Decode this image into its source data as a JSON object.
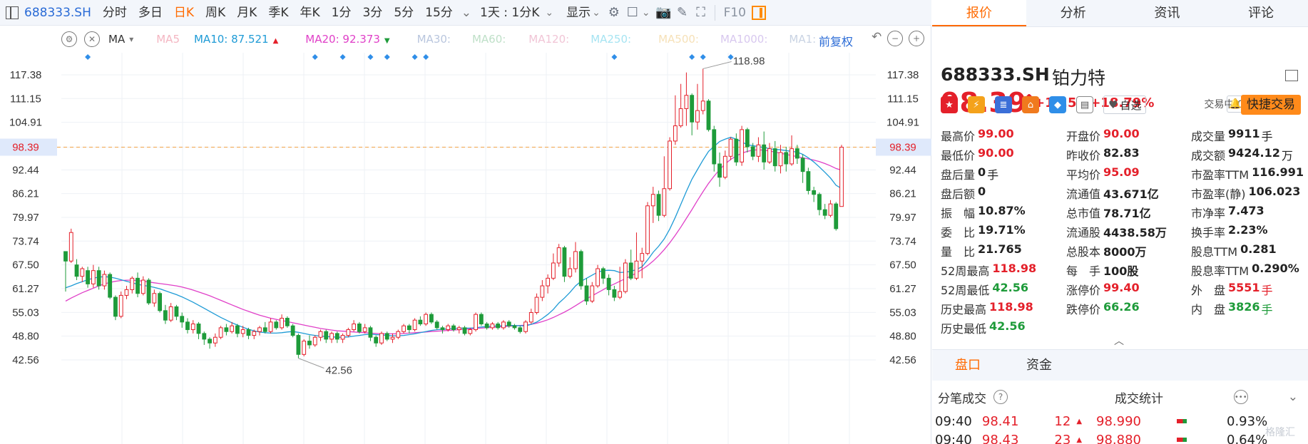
{
  "toolbar": {
    "code": "688333.SH",
    "periods": [
      "分时",
      "多日",
      "日K",
      "周K",
      "月K",
      "季K",
      "年K",
      "1分",
      "3分",
      "5分",
      "15分"
    ],
    "active_period": "日K",
    "more_chevron": "⌄",
    "interval_select": "1天 : 1分K",
    "display_label": "显示",
    "f10": "F10"
  },
  "ma_bar": {
    "ma_label": "MA",
    "items": [
      {
        "text": "MA5",
        "color": "#f4b6c2"
      },
      {
        "text": "MA10: 87.521",
        "color": "#1f9bd6",
        "arrow": "▲",
        "arrow_color": "#e4202a"
      },
      {
        "text": "MA20: 92.373",
        "color": "#e040c8",
        "arrow": "▼",
        "arrow_color": "#1e9b3a"
      },
      {
        "text": "MA30:",
        "color": "#b9c6de"
      },
      {
        "text": "MA60:",
        "color": "#bfe0c8"
      },
      {
        "text": "MA120:",
        "color": "#f1c5d6"
      },
      {
        "text": "MA250:",
        "color": "#a6e4f2"
      },
      {
        "text": "MA500:",
        "color": "#f6e1b8"
      },
      {
        "text": "MA1000:",
        "color": "#d8c8ef"
      },
      {
        "text": "MA1:",
        "color": "#c9d3e3"
      }
    ],
    "adjust_label": "前复权"
  },
  "chart_data": {
    "type": "candlestick",
    "y_ticks": [
      117.38,
      111.15,
      104.91,
      98.39,
      92.44,
      86.21,
      79.97,
      73.74,
      67.5,
      61.27,
      55.03,
      48.8,
      42.56
    ],
    "ylim": [
      40.2,
      121.4
    ],
    "current_price_label": "98.39",
    "high_annotation": "118.98",
    "low_annotation": "42.56",
    "ma10_color": "#1f9bd6",
    "ma20_color": "#e040c8",
    "up_color": "#e4202a",
    "down_color": "#1e9b3a",
    "candles": [
      [
        71.0,
        68.5,
        71.0,
        60.5
      ],
      [
        68.5,
        76.0,
        77.0,
        68.0
      ],
      [
        67.5,
        64.5,
        69.0,
        63.5
      ],
      [
        64.5,
        66.5,
        67.0,
        63.0
      ],
      [
        66.0,
        62.5,
        67.0,
        61.5
      ],
      [
        62.5,
        66.0,
        67.5,
        61.5
      ],
      [
        66.0,
        62.0,
        67.0,
        61.0
      ],
      [
        62.0,
        65.0,
        66.0,
        61.0
      ],
      [
        65.0,
        59.0,
        65.5,
        58.5
      ],
      [
        59.0,
        54.0,
        59.5,
        53.0
      ],
      [
        54.0,
        59.5,
        60.5,
        53.5
      ],
      [
        59.5,
        61.0,
        62.0,
        58.5
      ],
      [
        61.0,
        64.0,
        64.5,
        60.0
      ],
      [
        64.0,
        60.0,
        65.5,
        59.0
      ],
      [
        60.0,
        63.5,
        64.5,
        59.5
      ],
      [
        63.5,
        57.5,
        64.0,
        57.0
      ],
      [
        57.5,
        60.0,
        61.0,
        56.5
      ],
      [
        60.0,
        55.5,
        60.5,
        55.0
      ],
      [
        55.5,
        53.0,
        57.0,
        52.0
      ],
      [
        53.0,
        56.5,
        57.5,
        52.5
      ],
      [
        56.5,
        54.0,
        57.0,
        53.0
      ],
      [
        54.0,
        52.5,
        55.0,
        51.0
      ],
      [
        52.5,
        50.5,
        53.5,
        49.5
      ],
      [
        50.5,
        52.0,
        53.0,
        49.5
      ],
      [
        52.0,
        49.5,
        52.5,
        48.0
      ],
      [
        49.5,
        48.0,
        50.0,
        46.5
      ],
      [
        48.0,
        47.0,
        48.5,
        45.5
      ],
      [
        47.0,
        48.5,
        49.5,
        46.0
      ],
      [
        48.5,
        51.0,
        51.5,
        48.0
      ],
      [
        51.0,
        50.0,
        52.0,
        49.0
      ],
      [
        50.0,
        51.5,
        52.5,
        49.5
      ],
      [
        51.5,
        49.5,
        52.0,
        48.5
      ],
      [
        49.5,
        50.5,
        51.5,
        48.5
      ],
      [
        50.5,
        49.0,
        51.0,
        48.0
      ],
      [
        49.0,
        50.0,
        50.5,
        48.0
      ],
      [
        50.0,
        51.0,
        51.5,
        49.0
      ],
      [
        51.0,
        50.0,
        52.5,
        49.5
      ],
      [
        50.0,
        52.5,
        53.5,
        49.5
      ],
      [
        52.5,
        51.0,
        53.0,
        50.5
      ],
      [
        51.0,
        53.5,
        54.5,
        50.5
      ],
      [
        53.5,
        51.5,
        54.0,
        51.0
      ],
      [
        51.5,
        49.0,
        52.0,
        48.5
      ],
      [
        49.0,
        44.0,
        49.5,
        43.0
      ],
      [
        44.0,
        47.5,
        48.0,
        43.5
      ],
      [
        47.5,
        46.5,
        49.0,
        45.5
      ],
      [
        46.5,
        48.5,
        49.0,
        46.0
      ],
      [
        48.5,
        50.0,
        50.5,
        47.5
      ],
      [
        50.0,
        48.0,
        50.5,
        47.0
      ],
      [
        48.0,
        49.5,
        50.0,
        47.0
      ],
      [
        49.5,
        48.0,
        50.0,
        47.0
      ],
      [
        48.0,
        49.0,
        49.5,
        47.0
      ],
      [
        49.0,
        50.5,
        51.0,
        48.5
      ],
      [
        50.5,
        52.0,
        53.0,
        50.0
      ],
      [
        52.0,
        50.0,
        52.5,
        49.5
      ],
      [
        50.0,
        51.0,
        52.0,
        49.5
      ],
      [
        51.0,
        48.5,
        51.5,
        47.5
      ],
      [
        48.5,
        47.0,
        49.0,
        46.0
      ],
      [
        47.0,
        49.5,
        50.0,
        46.5
      ],
      [
        49.5,
        48.0,
        50.0,
        47.5
      ],
      [
        48.0,
        48.5,
        49.5,
        47.0
      ],
      [
        48.5,
        50.0,
        50.5,
        48.0
      ],
      [
        50.0,
        51.5,
        52.0,
        49.5
      ],
      [
        51.5,
        50.5,
        52.0,
        49.5
      ],
      [
        50.5,
        53.0,
        53.5,
        50.0
      ],
      [
        53.0,
        52.0,
        54.0,
        51.5
      ],
      [
        52.0,
        54.5,
        55.0,
        51.5
      ],
      [
        54.5,
        52.5,
        55.0,
        52.0
      ],
      [
        52.5,
        51.0,
        53.0,
        50.5
      ],
      [
        51.0,
        50.5,
        51.5,
        49.5
      ],
      [
        50.5,
        51.5,
        52.0,
        50.0
      ],
      [
        51.5,
        50.5,
        52.0,
        50.0
      ],
      [
        50.5,
        51.0,
        51.5,
        49.5
      ],
      [
        51.0,
        49.5,
        51.5,
        49.0
      ],
      [
        49.5,
        50.5,
        51.0,
        49.0
      ],
      [
        50.5,
        54.5,
        55.0,
        50.0
      ],
      [
        54.5,
        52.0,
        55.0,
        51.5
      ],
      [
        52.0,
        51.0,
        52.5,
        50.5
      ],
      [
        51.0,
        52.0,
        52.5,
        50.5
      ],
      [
        52.0,
        51.0,
        52.5,
        50.5
      ],
      [
        51.0,
        52.5,
        53.0,
        50.5
      ],
      [
        52.5,
        51.5,
        53.0,
        51.0
      ],
      [
        51.5,
        51.0,
        52.0,
        50.5
      ],
      [
        51.0,
        50.0,
        51.5,
        49.5
      ],
      [
        50.0,
        52.5,
        53.0,
        49.5
      ],
      [
        52.5,
        55.0,
        56.0,
        52.0
      ],
      [
        55.0,
        59.0,
        60.0,
        54.5
      ],
      [
        59.0,
        62.0,
        63.5,
        58.0
      ],
      [
        62.0,
        64.0,
        65.0,
        60.0
      ],
      [
        64.0,
        68.0,
        70.5,
        63.5
      ],
      [
        68.0,
        72.0,
        73.0,
        67.0
      ],
      [
        72.0,
        64.5,
        72.5,
        63.0
      ],
      [
        64.5,
        66.5,
        69.5,
        64.0
      ],
      [
        66.5,
        71.0,
        73.5,
        65.5
      ],
      [
        71.0,
        62.0,
        71.5,
        61.0
      ],
      [
        62.0,
        58.0,
        64.0,
        57.0
      ],
      [
        58.0,
        62.0,
        63.0,
        57.5
      ],
      [
        62.0,
        66.5,
        67.5,
        61.5
      ],
      [
        66.5,
        64.0,
        67.0,
        62.5
      ],
      [
        64.0,
        61.0,
        65.0,
        59.5
      ],
      [
        61.0,
        59.0,
        62.0,
        58.0
      ],
      [
        59.0,
        60.5,
        67.0,
        58.5
      ],
      [
        60.5,
        68.0,
        69.0,
        60.0
      ],
      [
        68.0,
        64.0,
        71.5,
        63.5
      ],
      [
        64.0,
        68.5,
        76.0,
        63.5
      ],
      [
        68.5,
        70.5,
        72.0,
        64.0
      ],
      [
        70.5,
        83.0,
        84.0,
        70.0
      ],
      [
        83.0,
        86.0,
        88.0,
        78.5
      ],
      [
        86.0,
        80.5,
        87.0,
        79.0
      ],
      [
        80.5,
        87.5,
        96.0,
        80.0
      ],
      [
        87.5,
        100.0,
        101.0,
        87.0
      ],
      [
        100.0,
        104.0,
        112.0,
        99.0
      ],
      [
        104.0,
        108.5,
        115.0,
        103.5
      ],
      [
        108.5,
        112.0,
        118.0,
        104.0
      ],
      [
        112.0,
        105.0,
        112.5,
        101.5
      ],
      [
        105.0,
        108.0,
        115.0,
        103.0
      ],
      [
        108.0,
        110.5,
        118.98,
        107.0
      ],
      [
        110.5,
        103.0,
        111.0,
        102.5
      ],
      [
        103.0,
        94.0,
        104.0,
        92.0
      ],
      [
        94.0,
        90.5,
        97.0,
        88.0
      ],
      [
        90.5,
        96.0,
        97.5,
        90.0
      ],
      [
        96.0,
        100.5,
        101.0,
        95.0
      ],
      [
        100.5,
        94.5,
        102.0,
        93.5
      ],
      [
        94.5,
        103.0,
        104.0,
        93.5
      ],
      [
        103.0,
        98.5,
        103.5,
        97.0
      ],
      [
        98.5,
        96.0,
        99.5,
        95.0
      ],
      [
        96.0,
        99.0,
        101.0,
        94.5
      ],
      [
        99.0,
        94.5,
        102.5,
        92.5
      ],
      [
        94.5,
        98.0,
        99.5,
        94.0
      ],
      [
        98.0,
        93.5,
        100.0,
        92.0
      ],
      [
        93.5,
        97.0,
        99.0,
        91.5
      ],
      [
        97.0,
        94.0,
        98.5,
        92.0
      ],
      [
        94.0,
        98.0,
        101.5,
        93.5
      ],
      [
        98.0,
        95.5,
        99.0,
        94.0
      ],
      [
        95.5,
        92.0,
        96.5,
        89.0
      ],
      [
        92.0,
        87.0,
        93.0,
        86.0
      ],
      [
        87.0,
        86.0,
        88.0,
        84.0
      ],
      [
        86.0,
        82.0,
        86.5,
        80.5
      ],
      [
        82.0,
        80.5,
        83.5,
        79.5
      ],
      [
        80.5,
        83.5,
        84.5,
        80.0
      ],
      [
        83.5,
        77.0,
        84.0,
        76.5
      ],
      [
        82.83,
        98.39,
        99.0,
        90.0
      ]
    ],
    "ma10": [
      61.5,
      62.0,
      62.6,
      63.1,
      63.6,
      64.0,
      64.3,
      64.4,
      64.3,
      64.0,
      63.6,
      63.2,
      62.8,
      62.4,
      62.1,
      61.9,
      61.6,
      61.2,
      60.7,
      60.2,
      59.7,
      59.1,
      58.4,
      57.7,
      56.9,
      56.1,
      55.3,
      54.5,
      53.7,
      53.0,
      52.3,
      51.7,
      51.1,
      50.6,
      50.2,
      49.9,
      49.7,
      49.6,
      49.6,
      49.7,
      49.9,
      50.0,
      49.8,
      49.5,
      49.2,
      49.0,
      48.8,
      48.7,
      48.6,
      48.5,
      48.5,
      48.6,
      48.8,
      49.0,
      49.2,
      49.3,
      49.2,
      49.1,
      49.0,
      48.9,
      48.9,
      49.0,
      49.2,
      49.4,
      49.7,
      50.0,
      50.3,
      50.5,
      50.6,
      50.7,
      50.8,
      50.9,
      50.9,
      50.9,
      51.0,
      51.2,
      51.3,
      51.4,
      51.5,
      51.5,
      51.6,
      51.6,
      51.5,
      51.5,
      51.9,
      52.5,
      53.4,
      54.5,
      55.8,
      57.5,
      58.8,
      60.3,
      62.0,
      63.2,
      64.0,
      64.8,
      65.6,
      66.0,
      66.1,
      66.0,
      65.5,
      65.6,
      65.8,
      66.3,
      67.0,
      68.8,
      70.8,
      72.4,
      74.3,
      76.9,
      80.0,
      83.4,
      86.8,
      90.0,
      92.5,
      95.0,
      97.3,
      98.6,
      99.9,
      100.5,
      101.0,
      100.5,
      99.8,
      99.0,
      98.8,
      98.5,
      98.3,
      98.0,
      97.8,
      97.7,
      97.5,
      97.3,
      97.1,
      96.5,
      95.6,
      94.5,
      93.2,
      91.8,
      90.3,
      88.4,
      87.521
    ],
    "ma20": [
      58.0,
      58.8,
      59.5,
      60.2,
      60.8,
      61.4,
      62.0,
      62.5,
      62.9,
      63.2,
      63.4,
      63.5,
      63.5,
      63.4,
      63.2,
      63.0,
      62.8,
      62.6,
      62.4,
      62.2,
      62.0,
      61.7,
      61.3,
      60.9,
      60.4,
      59.9,
      59.4,
      58.8,
      58.2,
      57.6,
      57.0,
      56.4,
      55.8,
      55.3,
      54.8,
      54.3,
      53.9,
      53.5,
      53.2,
      52.9,
      52.6,
      52.3,
      52.0,
      51.7,
      51.4,
      51.1,
      50.8,
      50.6,
      50.4,
      50.2,
      50.1,
      50.0,
      49.9,
      49.8,
      49.7,
      49.6,
      49.5,
      49.4,
      49.4,
      49.4,
      49.4,
      49.5,
      49.6,
      49.7,
      49.8,
      49.9,
      50.0,
      50.1,
      50.2,
      50.3,
      50.4,
      50.5,
      50.6,
      50.7,
      50.8,
      50.9,
      51.0,
      51.1,
      51.2,
      51.3,
      51.4,
      51.5,
      51.6,
      51.7,
      51.9,
      52.2,
      52.6,
      53.1,
      53.7,
      54.4,
      55.1,
      55.9,
      56.8,
      57.7,
      58.6,
      59.4,
      60.2,
      61.0,
      61.8,
      62.5,
      63.2,
      63.9,
      64.6,
      65.4,
      66.3,
      67.3,
      68.5,
      69.9,
      71.5,
      73.3,
      75.3,
      77.4,
      79.7,
      82.0,
      84.4,
      86.7,
      88.9,
      90.8,
      92.5,
      94.0,
      95.2,
      96.1,
      96.8,
      97.3,
      97.6,
      97.7,
      97.6,
      97.4,
      97.1,
      96.8,
      96.5,
      96.2,
      95.9,
      95.6,
      95.3,
      95.0,
      94.6,
      94.1,
      93.5,
      92.8,
      92.373
    ],
    "event_markers": [
      4,
      45,
      50,
      55,
      58,
      63,
      65,
      99,
      113,
      115,
      120
    ]
  },
  "quote": {
    "tabs": [
      "报价",
      "分析",
      "资讯",
      "评论"
    ],
    "active_tab": "报价",
    "code": "688333.SH",
    "name": "铂力特",
    "price": "98.39",
    "price_arrow": "🡅",
    "change": "+15.56",
    "change_pct": "+18.79%",
    "trade_status": "交易中 09/14 09:40",
    "watch_label": "自选",
    "quick_trade_label": "快捷交易",
    "stats": [
      [
        {
          "label": "最高价",
          "value": "99.00",
          "color": "red"
        },
        {
          "label": "开盘价",
          "value": "90.00",
          "color": "red"
        },
        {
          "label": "成交量",
          "value": "9911",
          "unit": "手",
          "color": "dark"
        }
      ],
      [
        {
          "label": "最低价",
          "value": "90.00",
          "color": "red"
        },
        {
          "label": "昨收价",
          "value": "82.83",
          "color": "dark"
        },
        {
          "label": "成交额",
          "value": "9424.12",
          "unit": "万",
          "color": "dark"
        }
      ],
      [
        {
          "label": "盘后量",
          "value": "0",
          "unit": "手",
          "color": "dark"
        },
        {
          "label": "平均价",
          "value": "95.09",
          "color": "red"
        },
        {
          "label": "市盈率TTM",
          "value": "116.991",
          "color": "dark"
        }
      ],
      [
        {
          "label": "盘后额",
          "value": "0",
          "color": "dark"
        },
        {
          "label": "流通值",
          "value": "43.671亿",
          "color": "dark"
        },
        {
          "label": "市盈率(静)",
          "value": "106.023",
          "color": "dark"
        }
      ],
      [
        {
          "label": "振　幅",
          "value": "10.87%",
          "color": "dark"
        },
        {
          "label": "总市值",
          "value": "78.71亿",
          "color": "dark"
        },
        {
          "label": "市净率",
          "value": "7.473",
          "color": "dark"
        }
      ],
      [
        {
          "label": "委　比",
          "value": "19.71%",
          "color": "dark"
        },
        {
          "label": "流通股",
          "value": "4438.58万",
          "color": "dark"
        },
        {
          "label": "换手率",
          "value": "2.23%",
          "color": "dark"
        }
      ],
      [
        {
          "label": "量　比",
          "value": "21.765",
          "color": "dark"
        },
        {
          "label": "总股本",
          "value": "8000万",
          "color": "dark"
        },
        {
          "label": "股息TTM",
          "value": "0.281",
          "color": "dark"
        }
      ],
      [
        {
          "label": "52周最高",
          "value": "118.98",
          "color": "red"
        },
        {
          "label": "每　手",
          "value": "100股",
          "color": "dark"
        },
        {
          "label": "股息率TTM",
          "value": "0.290%",
          "color": "dark"
        }
      ],
      [
        {
          "label": "52周最低",
          "value": "42.56",
          "color": "green"
        },
        {
          "label": "涨停价",
          "value": "99.40",
          "color": "red"
        },
        {
          "label": "外　盘",
          "value": "5551",
          "unit": "手",
          "color": "red"
        }
      ],
      [
        {
          "label": "历史最高",
          "value": "118.98",
          "color": "red"
        },
        {
          "label": "跌停价",
          "value": "66.26",
          "color": "green"
        },
        {
          "label": "内　盘",
          "value": "3826",
          "unit": "手",
          "color": "green"
        }
      ],
      [
        {
          "label": "历史最低",
          "value": "42.56",
          "color": "green"
        }
      ]
    ],
    "subtabs": [
      "盘口",
      "资金"
    ],
    "active_subtab": "盘口",
    "ticks_title": "分笔成交",
    "stats_title": "成交统计",
    "ticks": [
      {
        "time": "09:40",
        "price": "98.41",
        "vol": "12",
        "dir": "▲",
        "stat_price": "98.990",
        "stat_pct": "0.93%"
      },
      {
        "time": "09:40",
        "price": "98.43",
        "vol": "23",
        "dir": "▲",
        "stat_price": "98.880",
        "stat_pct": "0.64%"
      }
    ],
    "watermark": "格隆汇"
  }
}
